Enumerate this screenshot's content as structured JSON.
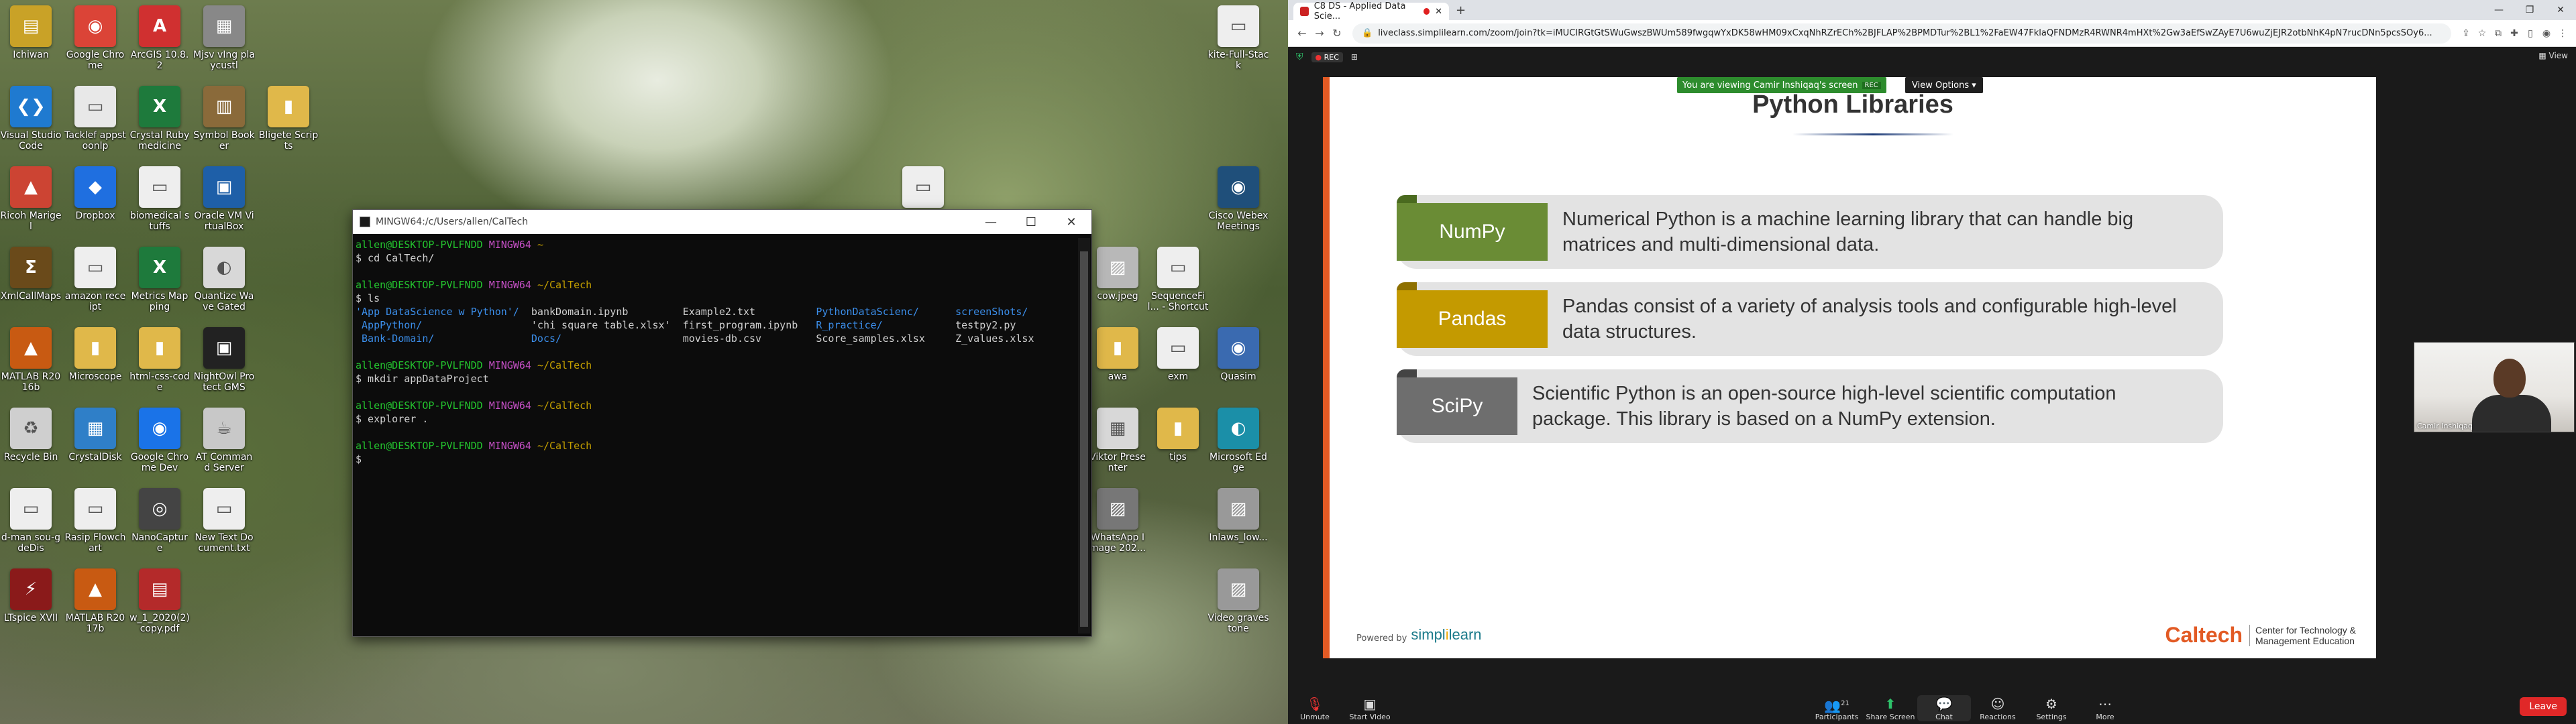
{
  "desktop": {
    "icons": [
      {
        "label": "Ichiwan",
        "color": "#c9a227",
        "glyph": "▤"
      },
      {
        "label": "Google Chrome",
        "color": "#db4437",
        "glyph": "◉"
      },
      {
        "label": "ArcGIS 10.8.2",
        "color": "#d03030",
        "glyph": "A"
      },
      {
        "label": "Mjsv vIng playcustl",
        "color": "#888888",
        "glyph": "▦"
      },
      {
        "label": "Visual Studio Code",
        "color": "#1f7ad0",
        "glyph": "❮❯"
      },
      {
        "label": "Tacklef appstoonlp",
        "color": "#e8e8e8",
        "glyph": "▭"
      },
      {
        "label": "Crystal Ruby medicine",
        "color": "#1e7a3c",
        "glyph": "X"
      },
      {
        "label": "Symbol Booker",
        "color": "#8a6a3a",
        "glyph": "▥"
      },
      {
        "label": "Bligete Scripts",
        "color": "#e0b84a",
        "glyph": "▮"
      },
      {
        "label": "Ricoh Marigel",
        "color": "#c43",
        "glyph": "▲"
      },
      {
        "label": "Dropbox",
        "color": "#1f6fe0",
        "glyph": "◆"
      },
      {
        "label": "biomedical stuffs",
        "color": "#eeeeee",
        "glyph": "▭"
      },
      {
        "label": "Oracle VM VirtualBox",
        "color": "#1e5fa8",
        "glyph": "▣"
      },
      {
        "label": "XmlCallMaps",
        "color": "#6a4a1a",
        "glyph": "Σ"
      },
      {
        "label": "amazon receipt",
        "color": "#eeeeee",
        "glyph": "▭"
      },
      {
        "label": "Metrics Mapping",
        "color": "#1e7a3c",
        "glyph": "X"
      },
      {
        "label": "Quantize Wave Gated",
        "color": "#d8d8d8",
        "glyph": "◐"
      },
      {
        "label": "MATLAB R2016b",
        "color": "#c85a12",
        "glyph": "▲"
      },
      {
        "label": "Microscope",
        "color": "#e0b84a",
        "glyph": "▮"
      },
      {
        "label": "html-css-code",
        "color": "#e0b84a",
        "glyph": "▮"
      },
      {
        "label": "NightOwl Protect GMS",
        "color": "#222222",
        "glyph": "▣"
      },
      {
        "label": "Recycle Bin",
        "color": "#cfcfcf",
        "glyph": "♻"
      },
      {
        "label": "CrystalDisk",
        "color": "#2f7fc8",
        "glyph": "▦"
      },
      {
        "label": "Google Chrome Dev",
        "color": "#1a73e8",
        "glyph": "◉"
      },
      {
        "label": "AT Command Server",
        "color": "#c8c8c8",
        "glyph": "☕"
      },
      {
        "label": "d-man sou-gdeDis",
        "color": "#eeeeee",
        "glyph": "▭"
      },
      {
        "label": "Rasip Flowchart",
        "color": "#eeeeee",
        "glyph": "▭"
      },
      {
        "label": "NanoCapture",
        "color": "#444444",
        "glyph": "◎"
      },
      {
        "label": "New Text Document.txt",
        "color": "#eeeeee",
        "glyph": "▭"
      },
      {
        "label": "LTspice XVII",
        "color": "#8a1a1a",
        "glyph": "⚡"
      },
      {
        "label": "MATLAB R2017b",
        "color": "#c85a12",
        "glyph": "▲"
      },
      {
        "label": "w_1_2020(2) copy.pdf",
        "color": "#b42a2a",
        "glyph": "▤"
      },
      {
        "label": "",
        "color": "#eeeeee",
        "glyph": "▭"
      },
      {
        "label": "kite-Full-Stack",
        "color": "#eeeeee",
        "glyph": "▭"
      },
      {
        "label": "Cisco Webex Meetings",
        "color": "#1f4f7a",
        "glyph": "◉"
      },
      {
        "label": "cow.jpeg",
        "color": "#b8b8b8",
        "glyph": "▨"
      },
      {
        "label": "SequenceFil... - Shortcut",
        "color": "#eeeeee",
        "glyph": "▭"
      },
      {
        "label": "awa",
        "color": "#e0b84a",
        "glyph": "▮"
      },
      {
        "label": "exm",
        "color": "#eeeeee",
        "glyph": "▭"
      },
      {
        "label": "Quasim",
        "color": "#3a6ab0",
        "glyph": "◉"
      },
      {
        "label": "Viktor Presenter",
        "color": "#d8d8d8",
        "glyph": "▦"
      },
      {
        "label": "tips",
        "color": "#e0b84a",
        "glyph": "▮"
      },
      {
        "label": "Microsoft Edge",
        "color": "#1b8fa8",
        "glyph": "◐"
      },
      {
        "label": "WhatsApp Image 202...",
        "color": "#777777",
        "glyph": "▨"
      },
      {
        "label": "Inlaws_low...",
        "color": "#999999",
        "glyph": "▨"
      },
      {
        "label": "Video gravestone",
        "color": "#999999",
        "glyph": "▨"
      }
    ]
  },
  "terminal": {
    "title": "MINGW64:/c/Users/allen/CalTech",
    "lines": [
      [
        {
          "t": "allen@DESKTOP-PVLFNDD ",
          "c": "green"
        },
        {
          "t": "MINGW64 ",
          "c": "mag"
        },
        {
          "t": "~",
          "c": "yel"
        }
      ],
      [
        {
          "t": "$ cd CalTech/",
          "c": ""
        }
      ],
      [
        {
          "t": "",
          "c": ""
        }
      ],
      [
        {
          "t": "allen@DESKTOP-PVLFNDD ",
          "c": "green"
        },
        {
          "t": "MINGW64 ",
          "c": "mag"
        },
        {
          "t": "~/CalTech",
          "c": "yel"
        }
      ],
      [
        {
          "t": "$ ls",
          "c": ""
        }
      ],
      [
        {
          "t": "'App DataScience w Python'/  ",
          "c": "blue"
        },
        {
          "t": "bankDomain.ipynb         ",
          "c": ""
        },
        {
          "t": "Example2.txt          ",
          "c": ""
        },
        {
          "t": "PythonDataScienc/      ",
          "c": "blue"
        },
        {
          "t": "screenShots/",
          "c": "blue"
        }
      ],
      [
        {
          "t": " AppPython/                  ",
          "c": "blue"
        },
        {
          "t": "'chi square table.xlsx'  ",
          "c": ""
        },
        {
          "t": "first_program.ipynb   ",
          "c": ""
        },
        {
          "t": "R_practice/            ",
          "c": "blue"
        },
        {
          "t": "testpy2.py",
          "c": ""
        }
      ],
      [
        {
          "t": " Bank-Domain/                ",
          "c": "blue"
        },
        {
          "t": "Docs/                    ",
          "c": "blue"
        },
        {
          "t": "movies-db.csv         ",
          "c": ""
        },
        {
          "t": "Score_samples.xlsx     ",
          "c": ""
        },
        {
          "t": "Z_values.xlsx",
          "c": ""
        }
      ],
      [
        {
          "t": "",
          "c": ""
        }
      ],
      [
        {
          "t": "allen@DESKTOP-PVLFNDD ",
          "c": "green"
        },
        {
          "t": "MINGW64 ",
          "c": "mag"
        },
        {
          "t": "~/CalTech",
          "c": "yel"
        }
      ],
      [
        {
          "t": "$ mkdir appDataProject",
          "c": ""
        }
      ],
      [
        {
          "t": "",
          "c": ""
        }
      ],
      [
        {
          "t": "allen@DESKTOP-PVLFNDD ",
          "c": "green"
        },
        {
          "t": "MINGW64 ",
          "c": "mag"
        },
        {
          "t": "~/CalTech",
          "c": "yel"
        }
      ],
      [
        {
          "t": "$ explorer .",
          "c": ""
        }
      ],
      [
        {
          "t": "",
          "c": ""
        }
      ],
      [
        {
          "t": "allen@DESKTOP-PVLFNDD ",
          "c": "green"
        },
        {
          "t": "MINGW64 ",
          "c": "mag"
        },
        {
          "t": "~/CalTech",
          "c": "yel"
        }
      ],
      [
        {
          "t": "$ ",
          "c": ""
        }
      ]
    ]
  },
  "browser": {
    "tab_title": "C8 DS - Applied Data Scie...",
    "new_tab": "+",
    "url": "liveclass.simplilearn.com/zoom/join?tk=iMUCIRGtGtSWuGwszBWUm589fwgqwYxDK58wHM09xCxqNhRZrECh%2BJFLAP%2BPMDTur%2BL1%2FaEW47FklaQFNDMzR4RWNR4mHXt%2Gw3aEfSwZAyE7U6wuZjEJR2otbNhK4pN7rucDNn5pcsSOy6..."
  },
  "zoom": {
    "view_label": "View",
    "rec_label": "REC",
    "banner_text": "You are viewing Camir Inshiqaq's screen",
    "banner_rec": "REC",
    "view_options": "View Options ▾",
    "participant_name": "Camir Inshiqaq",
    "toolbar": {
      "unmute": "Unmute",
      "start_video": "Start Video",
      "participants": "Participants",
      "participants_count": "21",
      "share_screen": "Share Screen",
      "chat": "Chat",
      "reactions": "Reactions",
      "settings": "Settings",
      "more": "More",
      "leave": "Leave"
    }
  },
  "slide": {
    "title": "Python Libraries",
    "libraries": [
      {
        "name": "NumPy",
        "desc": "Numerical Python is a machine learning library that can handle big matrices and multi-dimensional data.",
        "color": "#6a8c35",
        "fold": "#4a6a1f"
      },
      {
        "name": "Pandas",
        "desc": "Pandas consist of a variety of analysis tools and configurable high-level data structures.",
        "color": "#c49a00",
        "fold": "#8e7000"
      },
      {
        "name": "SciPy",
        "desc": "Scientific Python is an open-source high-level scientific computation package. This library is based on a NumPy extension.",
        "color": "#6e6e6e",
        "fold": "#444444"
      }
    ],
    "powered_by": "Powered by",
    "brand": "simplilearn",
    "caltech": "Caltech",
    "caltech_sub1": "Center for Technology &",
    "caltech_sub2": "Management Education"
  }
}
